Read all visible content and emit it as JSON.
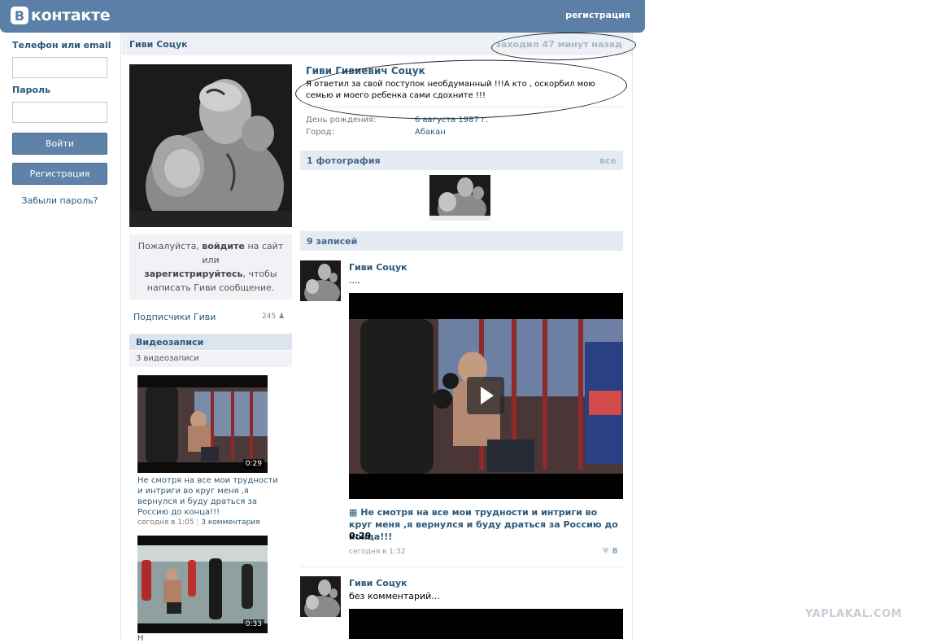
{
  "header": {
    "logo_letter": "B",
    "logo_text": "контакте",
    "register_link": "регистрация"
  },
  "login": {
    "phone_label": "Телефон или email",
    "password_label": "Пароль",
    "login_button": "Войти",
    "register_button": "Регистрация",
    "forgot_link": "Забыли пароль?"
  },
  "profile": {
    "short_name": "Гиви Соцук",
    "last_seen": "заходил 47 минут назад",
    "full_name": "Гиви Гивиевич Соцук",
    "status": "Я ответил за свой поступок необдуманный !!!А кто , оскорбил мою семью и моего ребенка сами сдохните !!!",
    "birthday_label": "День рождения:",
    "birthday_value": "6 августа 1987 г.",
    "city_label": "Город:",
    "city_value": "Абакан"
  },
  "message_box": {
    "p1": "Пожалуйста, ",
    "login_word": "войдите",
    "p2": " на сайт или ",
    "register_word": "зарегистрируйтесь",
    "p3": ", чтобы написать Гиви сообщение."
  },
  "subscribers": {
    "label": "Подписчики Гиви",
    "count": "245"
  },
  "videos": {
    "header": "Видеозаписи",
    "count_text": "3 видеозаписи",
    "items": [
      {
        "duration": "0:29",
        "title": "Не смотря на все мои трудности и интриги во круг меня ,я вернулся и буду драться за Россию до конца!!!",
        "date": "сегодня в 1:05",
        "comments": "3 комментария"
      },
      {
        "duration": "0:33",
        "title": "Н"
      }
    ]
  },
  "photos": {
    "header": "1 фотография",
    "all_link": "все"
  },
  "wall": {
    "header": "9 записей",
    "posts": [
      {
        "author": "Гиви Соцук",
        "text": "....",
        "video_title": "Не смотря на все мои трудности и интриги во круг меня ,я вернулся и буду драться за Россию до конца!!!",
        "video_duration": "0:29",
        "date": "сегодня в 1:32",
        "likes": "8"
      },
      {
        "author": "Гиви Соцук",
        "text": "без комментарий..."
      }
    ]
  },
  "watermark": "YAPLAKAL.COM",
  "colors": {
    "header_bg": "#5b7fa6",
    "link": "#2b587a",
    "button": "#5e82a8",
    "section_bg": "#e5ebf1"
  }
}
